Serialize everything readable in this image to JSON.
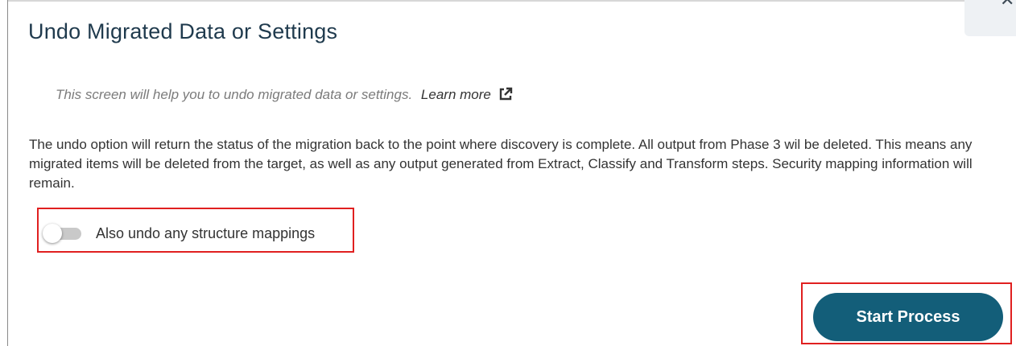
{
  "dialog": {
    "title": "Undo Migrated Data or Settings",
    "close_icon": "close-icon",
    "intro_text": "This screen will help you to undo migrated data or settings.",
    "learn_more_label": "Learn more",
    "learn_more_icon": "external-link-icon",
    "description": "The undo option will return the status of the migration back to the point where discovery is complete. All output from Phase 3 wil be deleted. This means any migrated items will be deleted from the target, as well as any output generated from Extract, Classify and Transform steps. Security mapping information will remain.",
    "toggle": {
      "label": "Also undo any structure mappings",
      "checked": false
    },
    "start_button_label": "Start Process"
  },
  "colors": {
    "title": "#1f3a4d",
    "primary_button": "#135e79",
    "highlight": "#e02020",
    "toggle_track_off": "#c9c9c9"
  }
}
